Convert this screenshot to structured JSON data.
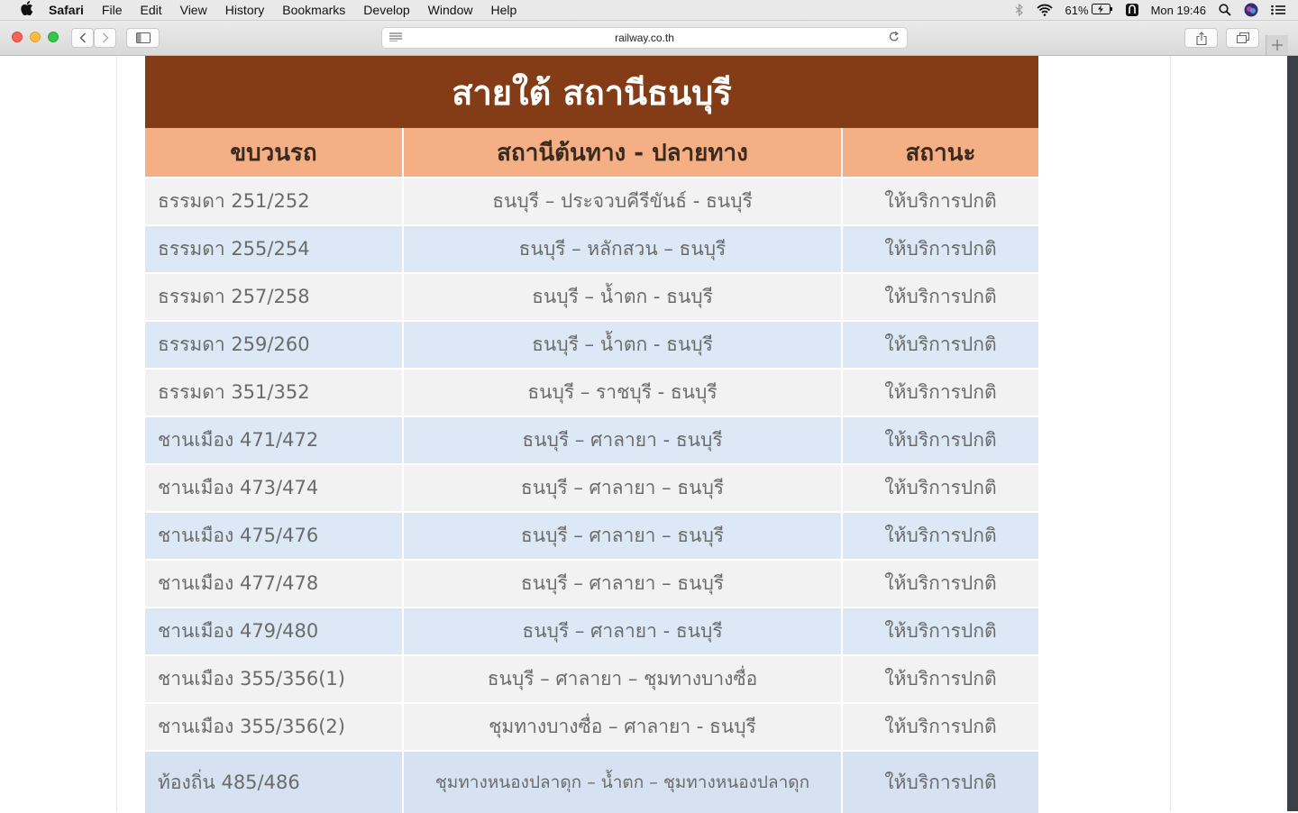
{
  "menubar": {
    "apple": "",
    "items": [
      "Safari",
      "File",
      "Edit",
      "View",
      "History",
      "Bookmarks",
      "Develop",
      "Window",
      "Help"
    ],
    "battery": "61%",
    "clock": "Mon 19:46"
  },
  "browser": {
    "url": "railway.co.th"
  },
  "table": {
    "title": "สายใต้ สถานีธนบุรี",
    "headers": [
      "ขบวนรถ",
      "สถานีต้นทาง - ปลายทาง",
      "สถานะ"
    ],
    "rows": [
      [
        "ธรรมดา 251/252",
        "ธนบุรี – ประจวบคีรีขันธ์ - ธนบุรี",
        "ให้บริการปกติ"
      ],
      [
        "ธรรมดา 255/254",
        "ธนบุรี – หลักสวน – ธนบุรี",
        "ให้บริการปกติ"
      ],
      [
        "ธรรมดา 257/258",
        "ธนบุรี – น้ำตก - ธนบุรี",
        "ให้บริการปกติ"
      ],
      [
        "ธรรมดา 259/260",
        "ธนบุรี – น้ำตก - ธนบุรี",
        "ให้บริการปกติ"
      ],
      [
        "ธรรมดา 351/352",
        "ธนบุรี – ราชบุรี - ธนบุรี",
        "ให้บริการปกติ"
      ],
      [
        "ชานเมือง 471/472",
        "ธนบุรี – ศาลายา - ธนบุรี",
        "ให้บริการปกติ"
      ],
      [
        "ชานเมือง 473/474",
        "ธนบุรี – ศาลายา – ธนบุรี",
        "ให้บริการปกติ"
      ],
      [
        "ชานเมือง 475/476",
        "ธนบุรี – ศาลายา – ธนบุรี",
        "ให้บริการปกติ"
      ],
      [
        "ชานเมือง 477/478",
        "ธนบุรี – ศาลายา – ธนบุรี",
        "ให้บริการปกติ"
      ],
      [
        "ชานเมือง 479/480",
        "ธนบุรี – ศาลายา - ธนบุรี",
        "ให้บริการปกติ"
      ],
      [
        "ชานเมือง 355/356(1)",
        "ธนบุรี – ศาลายา – ชุมทางบางซื่อ",
        "ให้บริการปกติ"
      ],
      [
        "ชานเมือง 355/356(2)",
        "ชุมทางบางซื่อ – ศาลายา - ธนบุรี",
        "ให้บริการปกติ"
      ],
      [
        "ท้องถิ่น 485/486",
        "ชุมทางหนองปลาดุก – น้ำตก – ชุมทางหนองปลาดุก",
        "ให้บริการปกติ"
      ]
    ]
  }
}
